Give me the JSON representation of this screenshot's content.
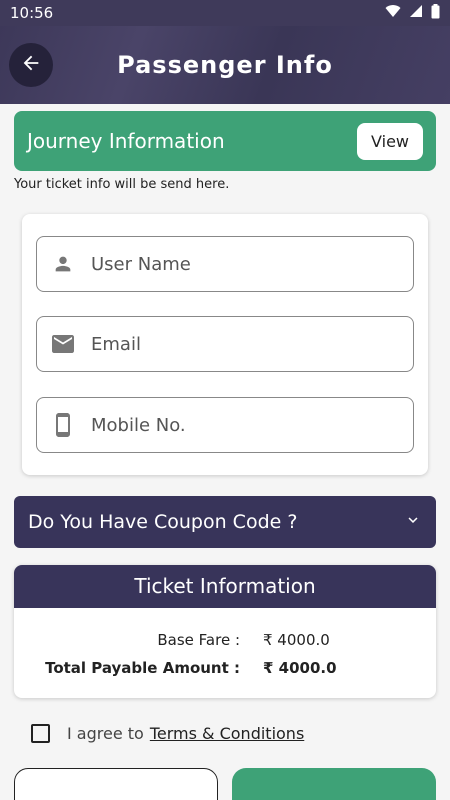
{
  "status_bar": {
    "time": "10:56",
    "icons": [
      "wifi-icon",
      "signal-icon",
      "battery-icon"
    ]
  },
  "app_bar": {
    "title": "Passenger Info",
    "back_icon": "arrow-left-icon"
  },
  "journey": {
    "title": "Journey Information",
    "view_label": "View"
  },
  "info_note": "Your ticket info will be send here.",
  "form": {
    "username_placeholder": "User Name",
    "email_placeholder": "Email",
    "mobile_placeholder": "Mobile No."
  },
  "coupon": {
    "label": "Do You Have Coupon Code ?"
  },
  "ticket": {
    "title": "Ticket Information",
    "rows": [
      {
        "label": "Base Fare :",
        "value": "₹ 4000.0"
      },
      {
        "label": "Total Payable Amount :",
        "value": "₹ 4000.0"
      }
    ]
  },
  "agreement": {
    "prefix": "I agree to",
    "link": "Terms & Conditions"
  },
  "colors": {
    "primary": "#38345a",
    "accent": "#3ea277"
  }
}
